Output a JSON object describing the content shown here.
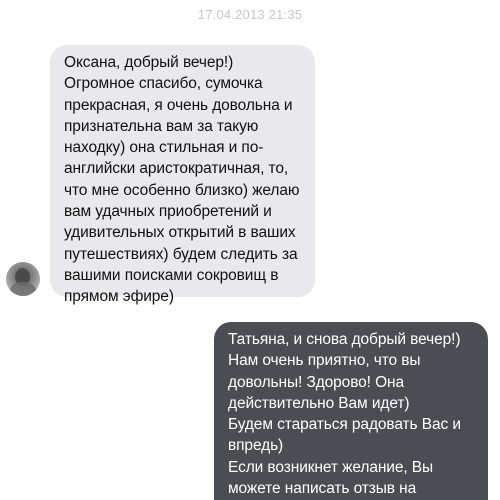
{
  "conversation": {
    "timestamp": "17.04.2013 21:35",
    "messages": [
      {
        "direction": "incoming",
        "text": "Оксана, добрый вечер!)\nОгромное спасибо, сумочка\nпрекрасная, я очень довольна и\nпризнательна вам за такую\nнаходку) она стильная и по-\nанглийски аристократичная, то,\nчто мне особенно близко) желаю\nвам удачных приобретений и\nудивительных открытий в ваших\nпутешествиях) будем следить за\nвашими поисками сокровищ в\nпрямом эфире)"
      },
      {
        "direction": "outgoing",
        "text": "Татьяна, и снова добрый вечер!)\nНам очень приятно, что вы\nдовольны! Здорово! Она\nдействительно Вам идет)\nБудем стараться радовать Вас и\nвпредь)\nЕсли возникнет желание, Вы\nможете написать отзыв на\nнашей странице как публикацию)"
      }
    ]
  },
  "colors": {
    "incoming_bubble": "#e9e9eb",
    "outgoing_bubble": "#4a4e52",
    "timestamp_text": "#c7c7cc"
  }
}
